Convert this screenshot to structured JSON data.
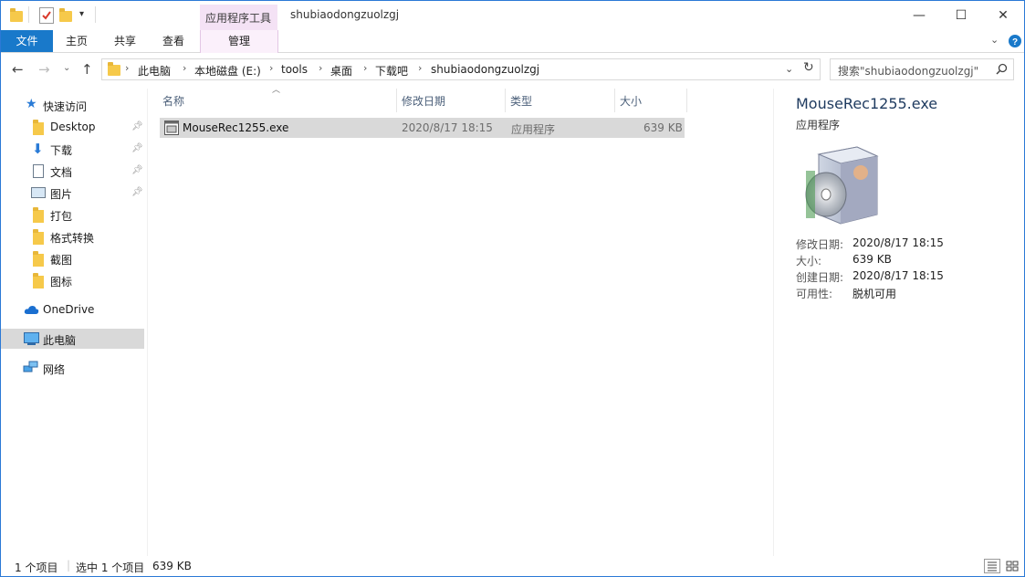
{
  "window": {
    "title": "shubiaodongzuolzgj",
    "context_tab_group": "应用程序工具"
  },
  "ribbon": {
    "tabs": [
      "文件",
      "主页",
      "共享",
      "查看",
      "管理"
    ]
  },
  "address": {
    "breadcrumbs": [
      "此电脑",
      "本地磁盘 (E:)",
      "tools",
      "桌面",
      "下载吧",
      "shubiaodongzuolzgj"
    ],
    "search_placeholder": "搜索\"shubiaodongzuolzgj\""
  },
  "nav": {
    "quick_access": "快速访问",
    "quick_items": [
      "Desktop",
      "下载",
      "文档",
      "图片",
      "打包",
      "格式转换",
      "截图",
      "图标"
    ],
    "onedrive": "OneDrive",
    "this_pc": "此电脑",
    "network": "网络"
  },
  "files": {
    "columns": [
      "名称",
      "修改日期",
      "类型",
      "大小"
    ],
    "rows": [
      {
        "name": "MouseRec1255.exe",
        "modified": "2020/8/17 18:15",
        "type": "应用程序",
        "size": "639 KB"
      }
    ]
  },
  "details": {
    "name": "MouseRec1255.exe",
    "type": "应用程序",
    "meta": [
      {
        "k": "修改日期:",
        "v": "2020/8/17 18:15"
      },
      {
        "k": "大小:",
        "v": "639 KB"
      },
      {
        "k": "创建日期:",
        "v": "2020/8/17 18:15"
      },
      {
        "k": "可用性:",
        "v": "脱机可用"
      }
    ]
  },
  "status": {
    "count": "1 个项目",
    "selected": "选中 1 个项目",
    "size": "639 KB"
  },
  "colors": {
    "accent": "#1979ca",
    "context_tab": "#f4e2f5",
    "selection": "#d9d9d9"
  }
}
